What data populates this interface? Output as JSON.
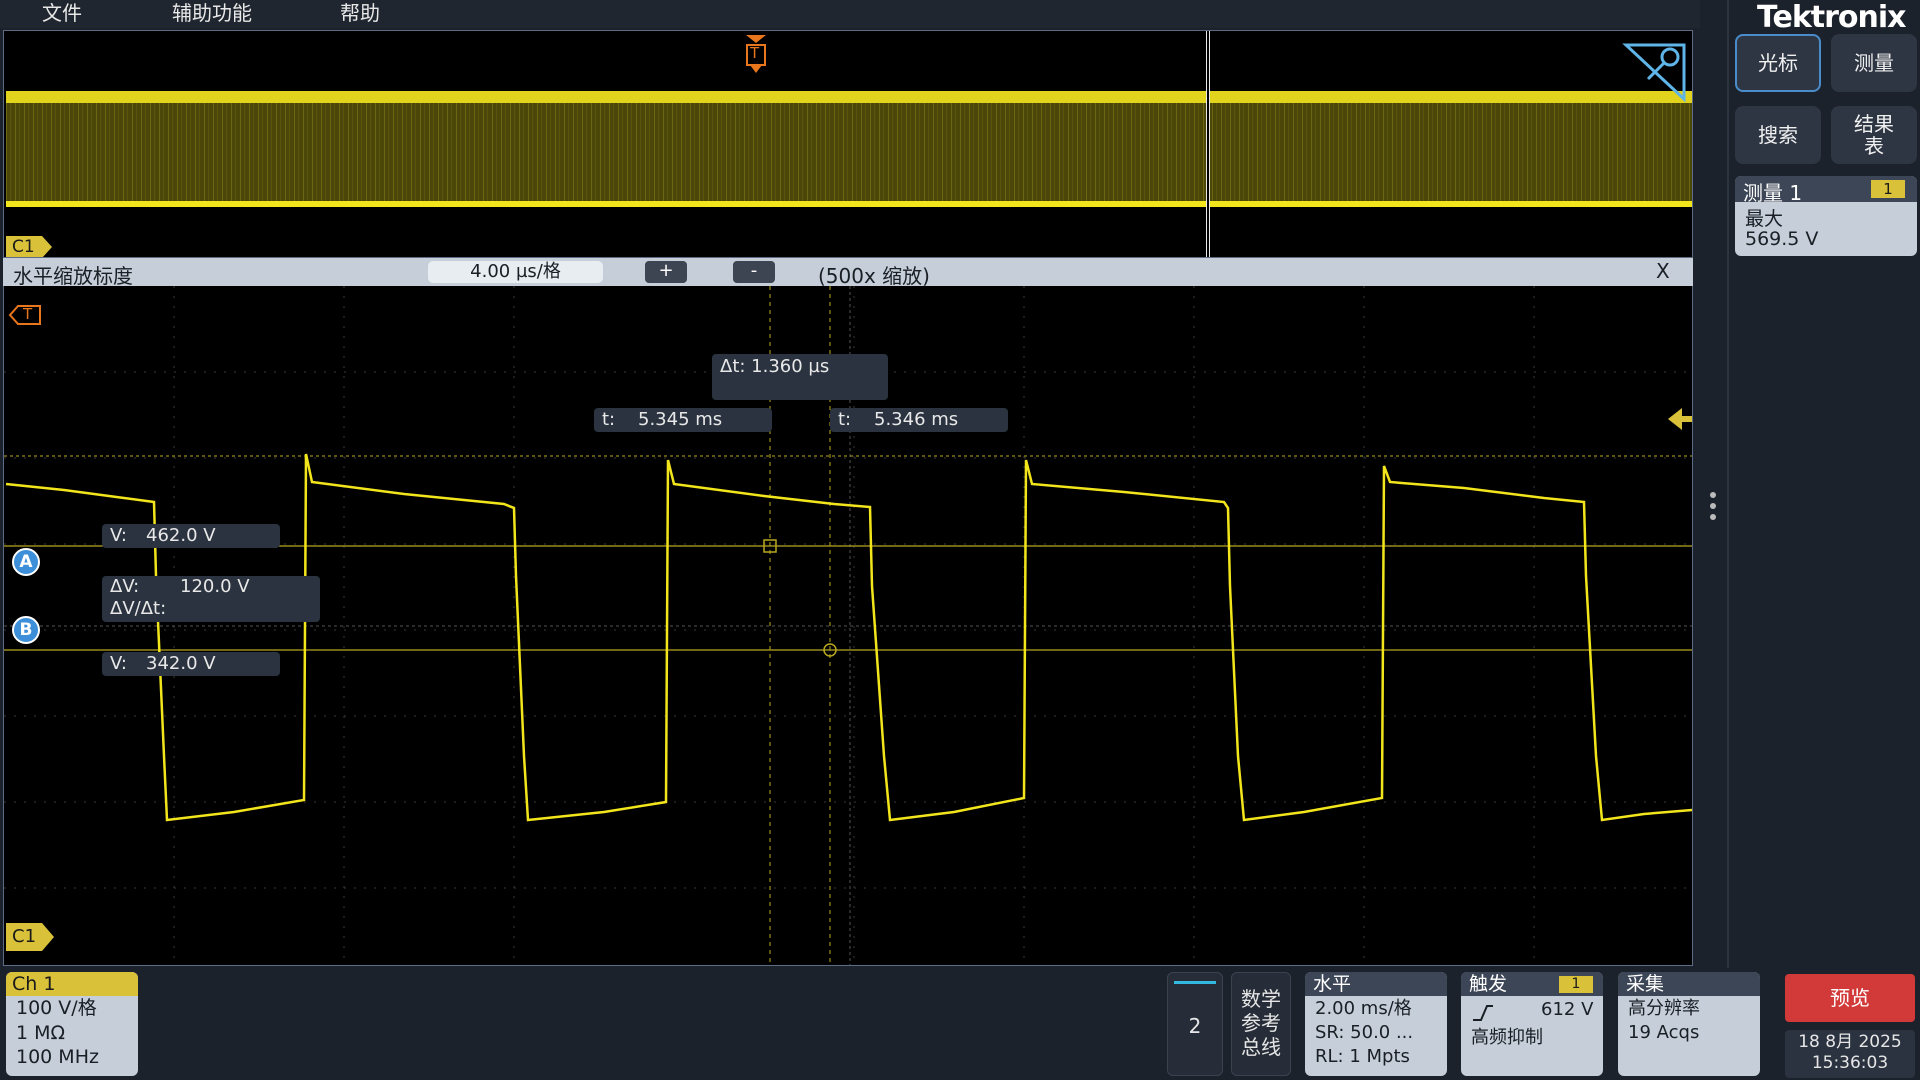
{
  "menu": {
    "file": "文件",
    "utilities": "辅助功能",
    "help": "帮助"
  },
  "brand": "Tektronix",
  "overview": {
    "trigger_marker": "T",
    "channel_tag": "C1"
  },
  "zoom": {
    "title": "水平缩放标度",
    "scale": "4.00 µs/格",
    "plus": "+",
    "minus": "-",
    "factor": "(500x 缩放)",
    "close": "X"
  },
  "waveform": {
    "channel_tag": "C1",
    "trigger_marker": "T",
    "delta_t": "Δt: 1.360 µs",
    "cursor_a_time_label": "t:",
    "cursor_a_time": "5.345 ms",
    "cursor_b_time_label": "t:",
    "cursor_b_time": "5.346 ms",
    "cursor_a_voltage_label": "V:",
    "cursor_a_voltage": "462.0 V",
    "delta_v_label": "ΔV:",
    "delta_v": "120.0 V",
    "dv_dt_label": "ΔV/Δt:",
    "cursor_b_voltage_label": "V:",
    "cursor_b_voltage": "342.0 V",
    "cursor_a": "A",
    "cursor_b": "B"
  },
  "side_buttons": {
    "cursor": "光标",
    "measure": "测量",
    "search": "搜索",
    "results_l1": "结果",
    "results_l2": "表"
  },
  "measurement": {
    "title": "测量 1",
    "badge": "1",
    "type": "最大",
    "value": "569.5 V"
  },
  "channel": {
    "name": "Ch 1",
    "scale": "100 V/格",
    "impedance": "1 MΩ",
    "bandwidth": "100 MHz"
  },
  "add_channel": "2",
  "math_ref_bus": {
    "l1": "数学",
    "l2": "参考",
    "l3": "总线"
  },
  "horizontal": {
    "title": "水平",
    "scale": "2.00 ms/格",
    "sample_rate": "SR: 50.0 ...",
    "record_length": "RL: 1 Mpts"
  },
  "trigger": {
    "title": "触发",
    "badge": "1",
    "level": "612 V",
    "coupling": "高频抑制"
  },
  "acquisition": {
    "title": "采集",
    "mode": "高分辨率",
    "count": "19 Acqs"
  },
  "preview_button": "预览",
  "date": "18 8月 2025",
  "time": "15:36:03",
  "colors": {
    "trace": "#f2e51b",
    "accent": "#d9c23a",
    "preview": "#d23a3a",
    "panel": "#2e3644"
  }
}
